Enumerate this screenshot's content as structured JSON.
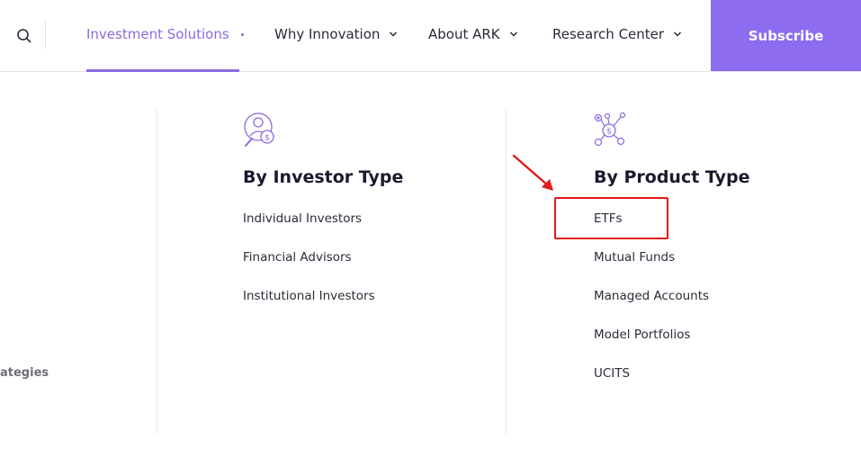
{
  "nav": {
    "items": [
      {
        "label": "Investment Solutions",
        "active": true
      },
      {
        "label": "Why Innovation"
      },
      {
        "label": "About ARK"
      },
      {
        "label": "Research Center"
      }
    ],
    "subscribe_label": "Subscribe",
    "search_icon": "search-icon"
  },
  "dropdown": {
    "left_partial_label": "ategies",
    "investor_type": {
      "heading": "By Investor Type",
      "icon": "investor-magnifier-icon",
      "links": [
        "Individual Investors",
        "Financial Advisors",
        "Institutional Investors"
      ]
    },
    "product_type": {
      "heading": "By Product Type",
      "icon": "product-network-icon",
      "links": [
        "ETFs",
        "Mutual Funds",
        "Managed Accounts",
        "Model Portfolios",
        "UCITS"
      ]
    }
  },
  "annotation": {
    "highlighted_item": "ETFs",
    "color": "#e01b1b"
  },
  "colors": {
    "accent": "#8d6cf0",
    "active_text": "#8b6ae0"
  }
}
